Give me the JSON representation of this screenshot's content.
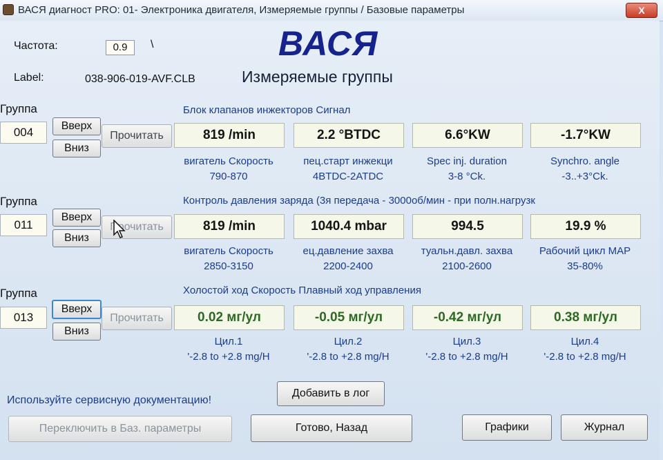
{
  "window": {
    "title": "ВАСЯ диагност PRO: 01- Электроника двигателя,  Измеряемые группы / Базовые параметры",
    "close_label": "X",
    "app_icon": "app-icon"
  },
  "header": {
    "logo": "ВАСЯ",
    "freq_label": "Частота:",
    "freq_value": "0.9",
    "freq_indicator": "\\",
    "label_caption": "Label:",
    "label_value": "038-906-019-AVF.CLB",
    "heading": "Измеряемые группы"
  },
  "groups": [
    {
      "caption": "Группа",
      "number": "004",
      "up": "Вверх",
      "down": "Вниз",
      "read": "Прочитать",
      "title": "Блок клапанов инжекторов Сигнал",
      "fields": [
        {
          "value": "819 /min",
          "name": "вигатель Скорость",
          "range": "790-870"
        },
        {
          "value": "2.2 °BTDC",
          "name": "пец.старт инжекци",
          "range": "4BTDC-2ATDC"
        },
        {
          "value": "6.6°KW",
          "name": "Spec inj. duration",
          "range": "3-8 °Ck."
        },
        {
          "value": "-1.7°KW",
          "name": "Synchro. angle",
          "range": "-3..+3°Ck."
        }
      ]
    },
    {
      "caption": "Группа",
      "number": "011",
      "up": "Вверх",
      "down": "Вниз",
      "read": "Прочитать",
      "title": "Контроль давления заряда (3я передача - 3000об/мин - при полн.нагрузк",
      "fields": [
        {
          "value": "819 /min",
          "name": "вигатель Скорость",
          "range": "2850-3150"
        },
        {
          "value": "1040.4 mbar",
          "name": "ец.давление захва",
          "range": "2200-2400"
        },
        {
          "value": "994.5",
          "name": "туальн.давл. захва",
          "range": "2100-2600"
        },
        {
          "value": "19.9 %",
          "name": "Рабочий цикл MAP",
          "range": "35-80%"
        }
      ]
    },
    {
      "caption": "Группа",
      "number": "013",
      "up": "Вверх",
      "down": "Вниз",
      "read": "Прочитать",
      "title": "Холостой ход Скорость Плавный ход управления",
      "fields": [
        {
          "value": "0.02 мг/ул",
          "name": "Цил.1",
          "range": "'-2.8 to +2.8 mg/H"
        },
        {
          "value": "-0.05 мг/ул",
          "name": "Цил.2",
          "range": "'-2.8 to +2.8 mg/H"
        },
        {
          "value": "-0.42 мг/ул",
          "name": "Цил.3",
          "range": "'-2.8 to +2.8 mg/H"
        },
        {
          "value": "0.38 мг/ул",
          "name": "Цил.4",
          "range": "'-2.8 to +2.8 mg/H"
        }
      ]
    }
  ],
  "footer": {
    "doc_hint": "Используйте сервисную документацию!",
    "add_log": "Добавить в лог",
    "switch_basic": "Переключить в Баз. параметры",
    "done_back": "Готово, Назад",
    "graphs": "Графики",
    "journal": "Журнал"
  },
  "colors": {
    "logo": "#17238c",
    "label_blue": "#1a3c8c",
    "value_green": "#2c6a23"
  }
}
